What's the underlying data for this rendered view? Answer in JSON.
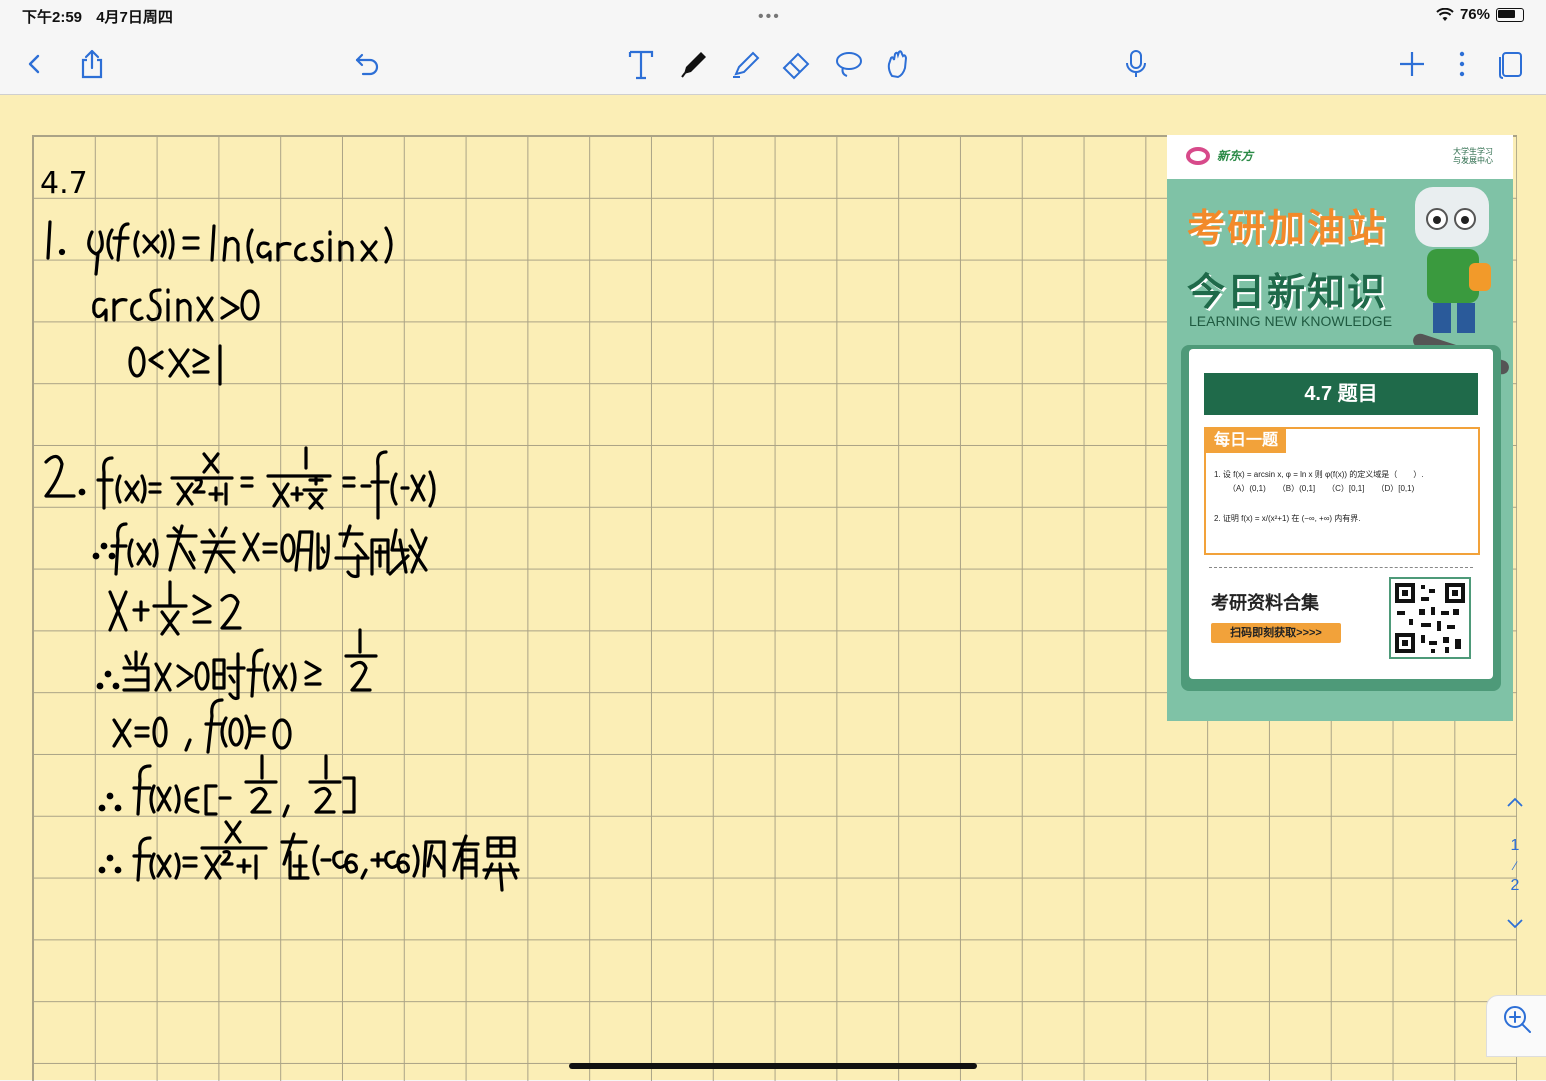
{
  "status": {
    "time": "下午2:59",
    "date": "4月7日周四",
    "battery": "76%",
    "battery_level": 0.76
  },
  "toolbar": {
    "icons": [
      "back-icon",
      "share-icon",
      "undo-icon",
      "text-tool-icon",
      "pen-icon",
      "highlighter-icon",
      "eraser-icon",
      "lasso-icon",
      "hand-icon",
      "microphone-icon",
      "add-icon",
      "more-icon",
      "pages-icon"
    ]
  },
  "note": {
    "date_label": "4.7"
  },
  "poster": {
    "brand": "新东方",
    "brand_right": "大学生学习\n与发展中心",
    "title1": "考研加油站",
    "title2": "今日新知识",
    "subtitle": "LEARNING NEW KNOWLEDGE",
    "banner": "4.7 题目",
    "daily_tag": "每日一题",
    "q1": "1. 设 f(x) = arcsin x, φ = ln x 则 φ(f(x)) 的定义域是（　　）.",
    "q1_options": "（A）(0,1)　　（B）(0,1]　　（C）[0,1]　　（D）[0,1)",
    "q2": "2. 证明 f(x) = x/(x²+1) 在 (−∞, +∞) 内有界.",
    "collect": "考研资料合集",
    "scan": "扫码即刻获取>>>>"
  },
  "pager": {
    "current": "1",
    "total": "2"
  }
}
